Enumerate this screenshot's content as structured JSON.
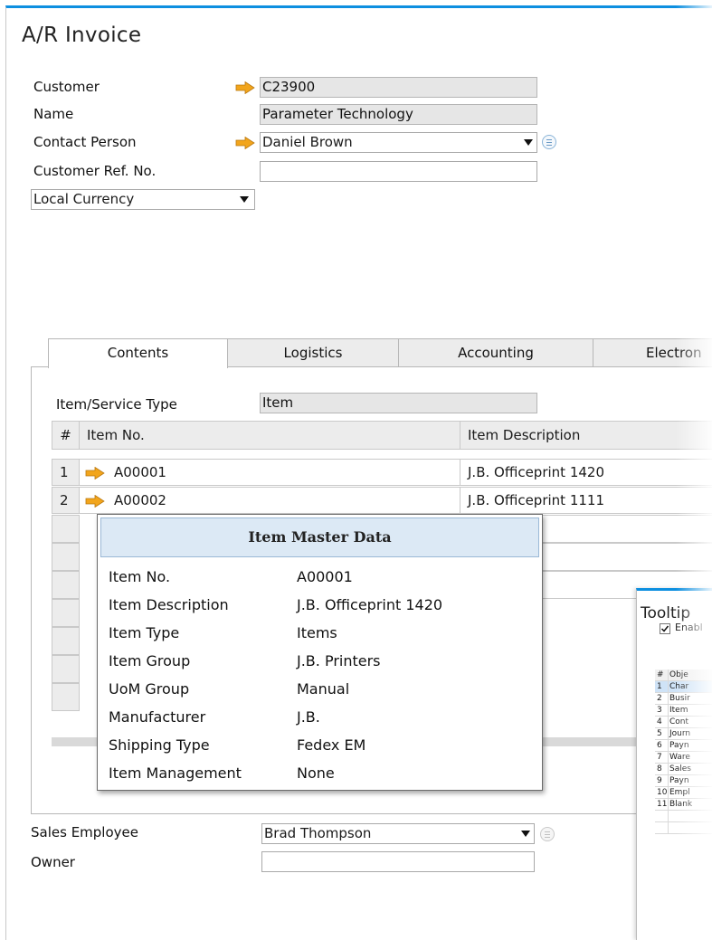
{
  "window": {
    "title": "A/R Invoice"
  },
  "header": {
    "customer_label": "Customer",
    "customer_value": "C23900",
    "name_label": "Name",
    "name_value": "Parameter Technology",
    "contact_label": "Contact Person",
    "contact_value": "Daniel Brown",
    "ref_label": "Customer Ref. No.",
    "ref_value": "",
    "currency_value": "Local Currency"
  },
  "tabs": [
    {
      "label": "Contents"
    },
    {
      "label": "Logistics"
    },
    {
      "label": "Accounting"
    },
    {
      "label": "Electron"
    }
  ],
  "contents": {
    "item_type_label": "Item/Service Type",
    "item_type_value": "Item",
    "columns": [
      "#",
      "Item No.",
      "Item Description"
    ],
    "rows": [
      {
        "num": "1",
        "item_no": "A00001",
        "desc": "J.B. Officeprint 1420"
      },
      {
        "num": "2",
        "item_no": "A00002",
        "desc": "J.B. Officeprint 1111"
      }
    ]
  },
  "popup": {
    "title": "Item Master Data",
    "fields": [
      {
        "label": "Item No.",
        "value": "A00001"
      },
      {
        "label": "Item Description",
        "value": "J.B. Officeprint 1420"
      },
      {
        "label": "Item Type",
        "value": "Items"
      },
      {
        "label": "Item Group",
        "value": "J.B. Printers"
      },
      {
        "label": "UoM Group",
        "value": "Manual"
      },
      {
        "label": "Manufacturer",
        "value": "J.B."
      },
      {
        "label": "Shipping Type",
        "value": "Fedex EM"
      },
      {
        "label": "Item Management",
        "value": "None"
      }
    ]
  },
  "footer": {
    "sales_employee_label": "Sales Employee",
    "sales_employee_value": "Brad Thompson",
    "owner_label": "Owner",
    "owner_value": ""
  },
  "tooltip_window": {
    "title": "Tooltip",
    "enable_label": "Enabl",
    "columns": [
      "#",
      "Obje"
    ],
    "rows": [
      {
        "n": "1",
        "t": "Char"
      },
      {
        "n": "2",
        "t": "Busir"
      },
      {
        "n": "3",
        "t": "Item"
      },
      {
        "n": "4",
        "t": "Cont"
      },
      {
        "n": "5",
        "t": "Journ"
      },
      {
        "n": "6",
        "t": "Payn"
      },
      {
        "n": "7",
        "t": "Ware"
      },
      {
        "n": "8",
        "t": "Sales"
      },
      {
        "n": "9",
        "t": "Payn"
      },
      {
        "n": "10",
        "t": "Empl"
      },
      {
        "n": "11",
        "t": "Blank"
      }
    ]
  },
  "icons": {
    "link_arrow": "golden-arrow-icon",
    "dropdown": "dropdown-triangle-icon",
    "choose": "choose-from-list-icon"
  },
  "colors": {
    "accent": "#0d8fe0",
    "arrow": "#f2a51c",
    "readonly_bg": "#e6e6e6",
    "popup_header": "#dce9f5"
  }
}
